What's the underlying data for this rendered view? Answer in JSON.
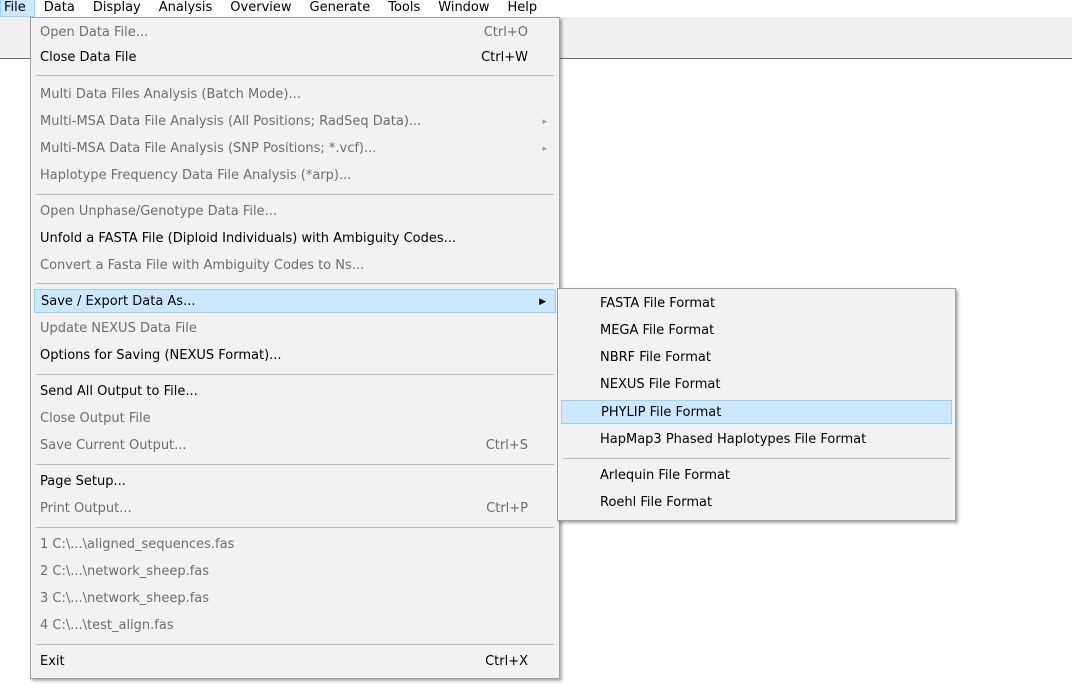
{
  "menubar": {
    "items": [
      {
        "label": "File"
      },
      {
        "label": "Data"
      },
      {
        "label": "Display"
      },
      {
        "label": "Analysis"
      },
      {
        "label": "Overview"
      },
      {
        "label": "Generate"
      },
      {
        "label": "Tools"
      },
      {
        "label": "Window"
      },
      {
        "label": "Help"
      }
    ]
  },
  "file_menu": {
    "open_data_file": {
      "label": "Open Data File...",
      "shortcut": "Ctrl+O"
    },
    "close_data_file": {
      "label": "Close Data File",
      "shortcut": "Ctrl+W"
    },
    "multi_data_files": {
      "label": "Multi Data Files Analysis (Batch Mode)..."
    },
    "multi_msa_all": {
      "label": "Multi-MSA Data File Analysis (All Positions; RadSeq Data)..."
    },
    "multi_msa_snp": {
      "label": "Multi-MSA Data File Analysis (SNP Positions; *.vcf)..."
    },
    "haplotype_freq": {
      "label": "Haplotype Frequency Data File Analysis (*arp)..."
    },
    "open_unphase": {
      "label": "Open Unphase/Genotype Data File..."
    },
    "unfold_fasta": {
      "label": "Unfold a FASTA File (Diploid Individuals) with Ambiguity Codes..."
    },
    "convert_fasta": {
      "label": "Convert a Fasta File with Ambiguity Codes to Ns..."
    },
    "save_export": {
      "label": "Save / Export Data As..."
    },
    "update_nexus": {
      "label": "Update NEXUS Data File"
    },
    "options_saving": {
      "label": "Options for Saving (NEXUS Format)..."
    },
    "send_output": {
      "label": "Send All Output to File..."
    },
    "close_output": {
      "label": "Close Output File"
    },
    "save_current_output": {
      "label": "Save Current Output...",
      "shortcut": "Ctrl+S"
    },
    "page_setup": {
      "label": "Page Setup..."
    },
    "print_output": {
      "label": "Print Output...",
      "shortcut": "Ctrl+P"
    },
    "recent": [
      {
        "label": "1 C:\\...\\aligned_sequences.fas"
      },
      {
        "label": "2 C:\\...\\network_sheep.fas"
      },
      {
        "label": "3 C:\\...\\network_sheep.fas"
      },
      {
        "label": "4 C:\\...\\test_align.fas"
      }
    ],
    "exit": {
      "label": "Exit",
      "shortcut": "Ctrl+X"
    }
  },
  "export_submenu": {
    "items": [
      {
        "label": "FASTA File Format"
      },
      {
        "label": "MEGA File Format"
      },
      {
        "label": "NBRF File Format"
      },
      {
        "label": "NEXUS File Format"
      },
      {
        "label": "PHYLIP File Format"
      },
      {
        "label": "HapMap3 Phased Haplotypes File Format"
      },
      {
        "label": "Arlequin File Format"
      },
      {
        "label": "Roehl File Format"
      }
    ]
  },
  "icons": {
    "submenu_arrow": "▸",
    "submenu_arrow_active": "▶"
  },
  "colors": {
    "highlight_bg": "#cce8ff",
    "highlight_border": "#99d1ff",
    "menu_bg": "#f2f2f2",
    "disabled_text": "#6d6d6d"
  }
}
